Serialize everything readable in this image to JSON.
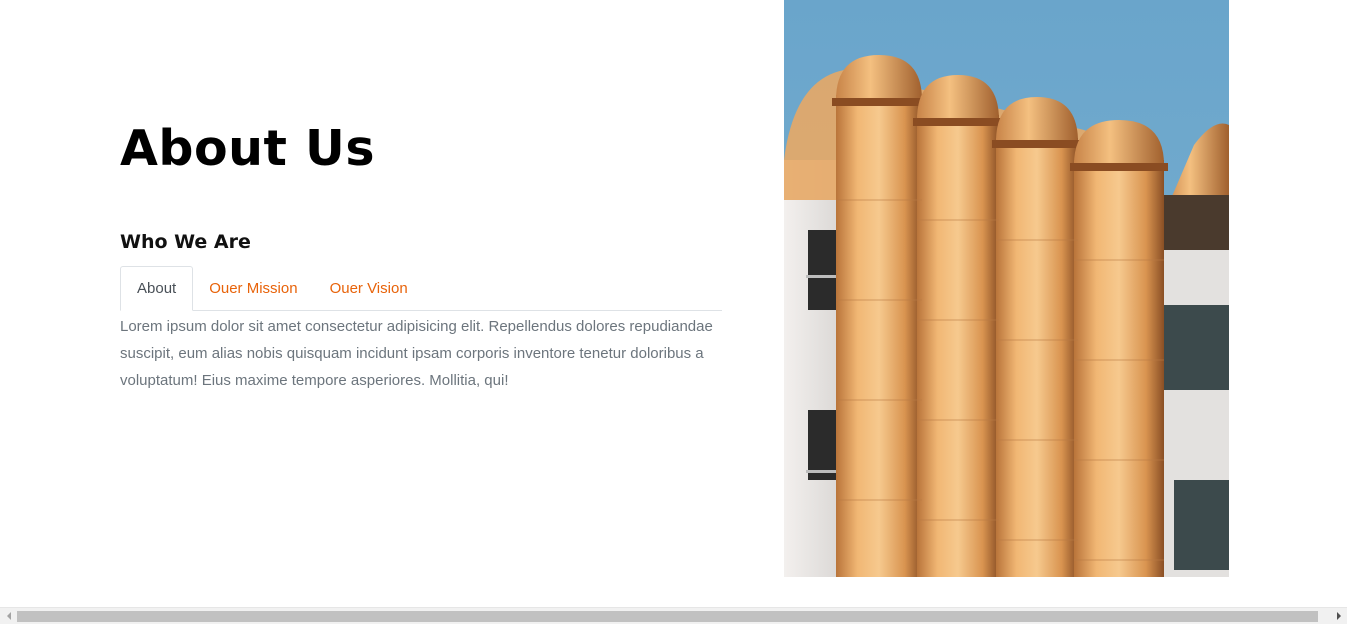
{
  "about": {
    "title": "About Us",
    "subtitle": "Who We Are",
    "tabs": [
      {
        "label": "About",
        "active": true
      },
      {
        "label": "Ouer Mission",
        "active": false
      },
      {
        "label": "Ouer Vision",
        "active": false
      }
    ],
    "panel_text": "Lorem ipsum dolor sit amet consectetur adipisicing elit. Repellendus dolores repudiandae suscipit, eum alias nobis quisquam incidunt ipsam corporis inventore tenetur doloribus a voluptatum! Eius maxime tempore asperiores. Mollitia, qui!"
  },
  "colors": {
    "accent": "#e8630a",
    "active_tab_text": "#495057",
    "body_text": "#6c757d",
    "sky": "#6aa5c9",
    "pipe": "#e9a55a"
  },
  "icons": {
    "scroll_left": "triangle-left",
    "scroll_right": "triangle-right"
  }
}
